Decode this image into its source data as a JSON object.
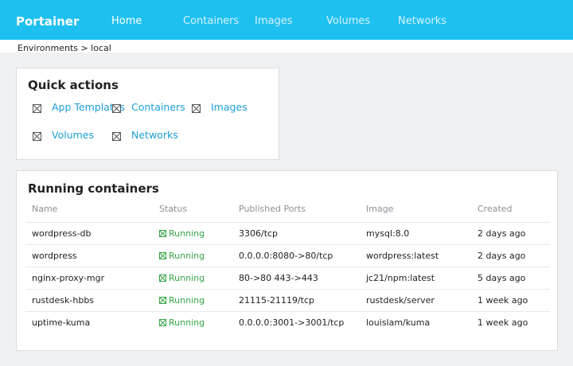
{
  "header": {
    "brand": "Portainer",
    "nav": [
      {
        "label": "Home",
        "active": true
      },
      {
        "label": "Containers",
        "active": false
      },
      {
        "label": "Images",
        "active": false
      },
      {
        "label": "Volumes",
        "active": false
      },
      {
        "label": "Networks",
        "active": false
      }
    ]
  },
  "breadcrumb": "Environments > local",
  "quick_actions": {
    "title": "Quick actions",
    "items": [
      {
        "label": "App Templates",
        "icon": "broken-image-icon"
      },
      {
        "label": "Containers",
        "icon": "broken-image-icon"
      },
      {
        "label": "Images",
        "icon": "broken-image-icon"
      },
      {
        "label": "Volumes",
        "icon": "broken-image-icon"
      },
      {
        "label": "Networks",
        "icon": "broken-image-icon"
      }
    ]
  },
  "running": {
    "title": "Running containers",
    "columns": [
      "Name",
      "Status",
      "Published Ports",
      "Image",
      "Created"
    ],
    "rows": [
      {
        "name": "wordpress-db",
        "status": "Running",
        "ports": "3306/tcp",
        "image": "mysql:8.0",
        "created": "2 days ago"
      },
      {
        "name": "wordpress",
        "status": "Running",
        "ports": "0.0.0.0:8080->80/tcp",
        "image": "wordpress:latest",
        "created": "2 days ago"
      },
      {
        "name": "nginx-proxy-mgr",
        "status": "Running",
        "ports": "80->80 443->443",
        "image": "jc21/npm:latest",
        "created": "5 days ago"
      },
      {
        "name": "rustdesk-hbbs",
        "status": "Running",
        "ports": "21115-21119/tcp",
        "image": "rustdesk/server",
        "created": "1 week ago"
      },
      {
        "name": "uptime-kuma",
        "status": "Running",
        "ports": "0.0.0.0:3001->3001/tcp",
        "image": "louislam/kuma",
        "created": "1 week ago"
      }
    ]
  },
  "colors": {
    "topbar": "#1ec0f0",
    "link": "#1b9fd6",
    "running": "#35a546",
    "background": "#eef0f2"
  }
}
